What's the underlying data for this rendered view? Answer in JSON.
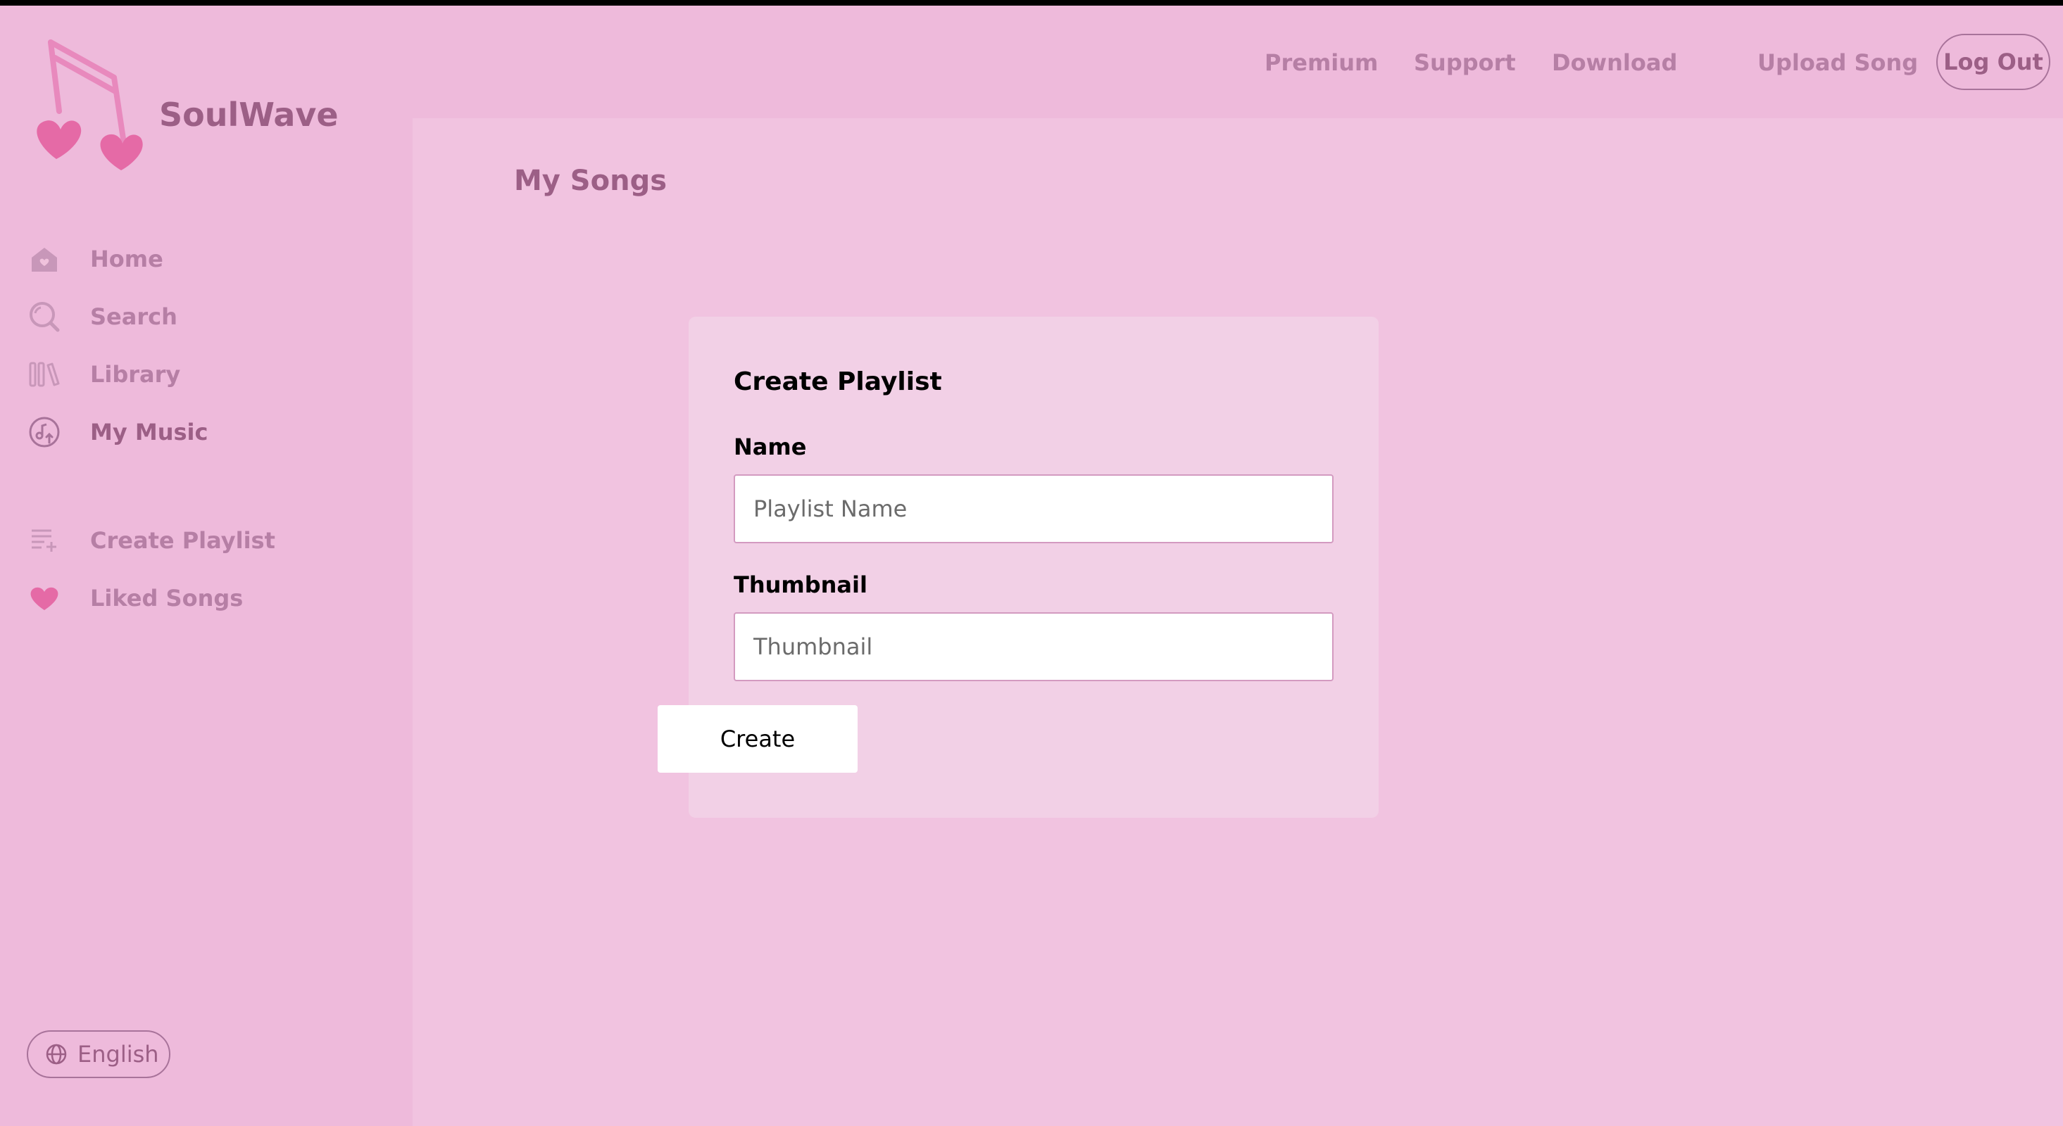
{
  "app": {
    "brand": "SoulWave"
  },
  "sidebar": {
    "items": [
      {
        "label": "Home",
        "icon": "home-heart-icon"
      },
      {
        "label": "Search",
        "icon": "search-icon"
      },
      {
        "label": "Library",
        "icon": "library-icon"
      },
      {
        "label": "My Music",
        "icon": "music-upload-icon",
        "active": true
      },
      {
        "label": "Create Playlist",
        "icon": "playlist-add-icon"
      },
      {
        "label": "Liked Songs",
        "icon": "heart-icon"
      }
    ],
    "language": "English"
  },
  "header": {
    "links": [
      "Premium",
      "Support",
      "Download",
      "Upload Song"
    ],
    "logout": "Log Out"
  },
  "main": {
    "title": "My Songs",
    "form": {
      "title": "Create Playlist",
      "name_label": "Name",
      "name_placeholder": "Playlist Name",
      "thumbnail_label": "Thumbnail",
      "thumbnail_placeholder": "Thumbnail",
      "submit": "Create"
    }
  },
  "colors": {
    "accent": "#9c5f86",
    "muted": "#b67fa5",
    "heart": "#e56aa6",
    "background": "#f0c2dc"
  }
}
